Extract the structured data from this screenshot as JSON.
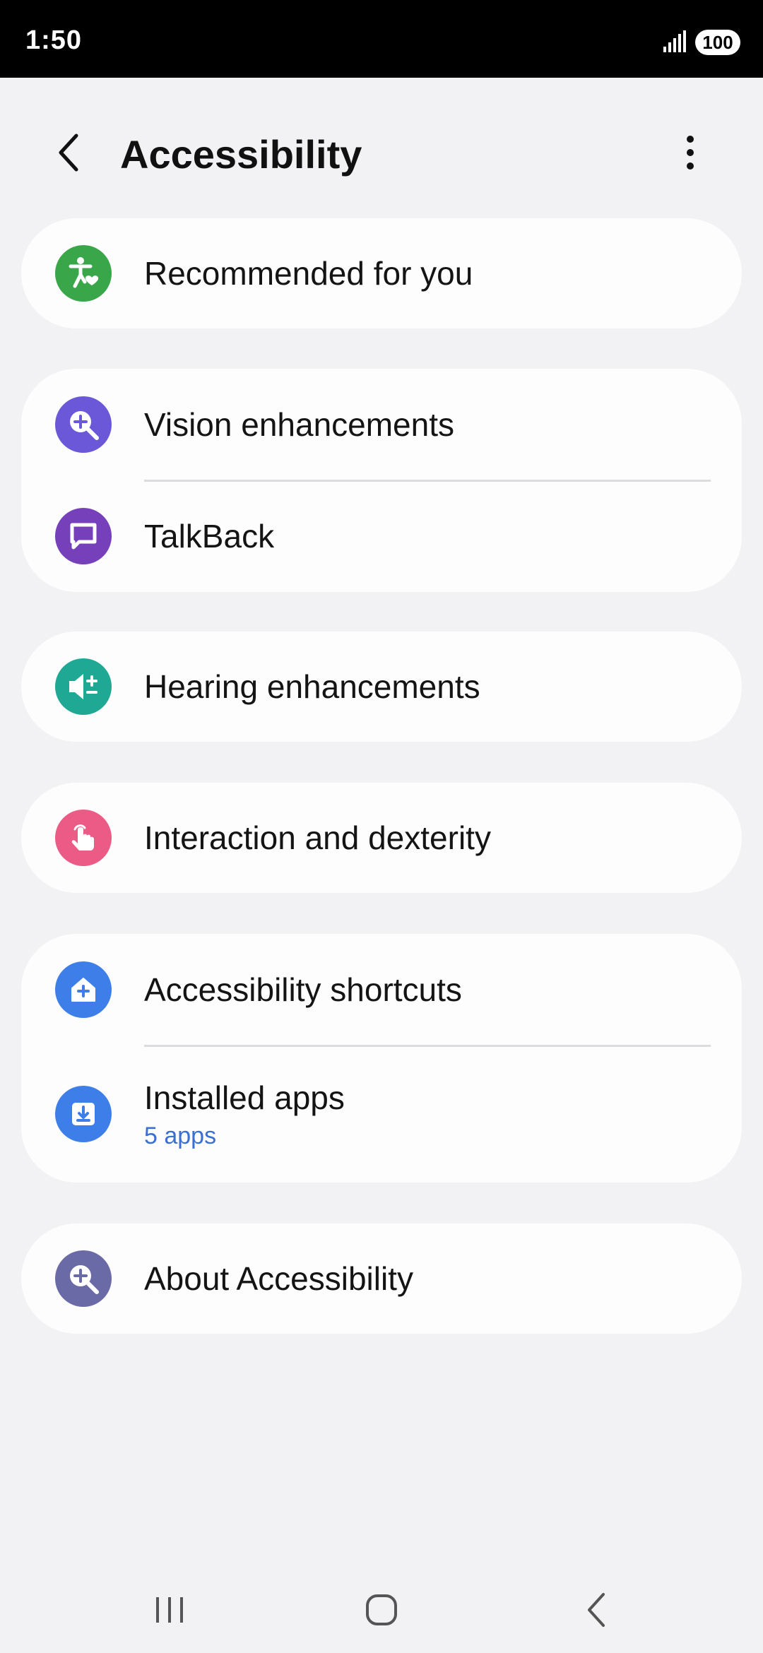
{
  "status_bar": {
    "time": "1:50",
    "battery": "100"
  },
  "header": {
    "title": "Accessibility"
  },
  "cards": [
    {
      "items": [
        {
          "label": "Recommended for you",
          "icon": "accessibility-heart-icon",
          "color": "#3aa64a"
        }
      ]
    },
    {
      "items": [
        {
          "label": "Vision enhancements",
          "icon": "magnifier-plus-icon",
          "color": "#6b58d9"
        },
        {
          "label": "TalkBack",
          "icon": "speech-bubble-icon",
          "color": "#7540b9"
        }
      ]
    },
    {
      "items": [
        {
          "label": "Hearing enhancements",
          "icon": "speaker-plusminus-icon",
          "color": "#1fa894"
        }
      ]
    },
    {
      "items": [
        {
          "label": "Interaction and dexterity",
          "icon": "tap-hand-icon",
          "color": "#ec5b85"
        }
      ]
    },
    {
      "items": [
        {
          "label": "Accessibility shortcuts",
          "icon": "home-plus-icon",
          "color": "#3d7ee9"
        },
        {
          "label": "Installed apps",
          "sub": "5 apps",
          "icon": "download-box-icon",
          "color": "#3d7ee9"
        }
      ]
    },
    {
      "items": [
        {
          "label": "About Accessibility",
          "icon": "magnifier-plus-icon",
          "color": "#6a6aa6"
        }
      ]
    }
  ]
}
